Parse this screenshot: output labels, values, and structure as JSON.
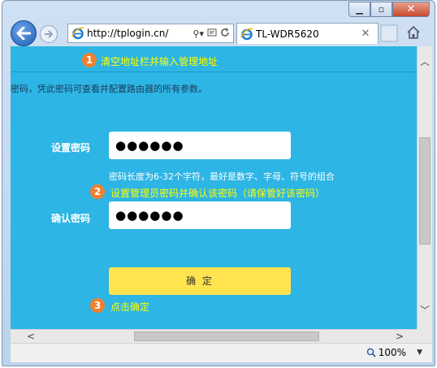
{
  "window": {
    "controls": {
      "minimize": "▁",
      "maximize": "▫",
      "close": "✕"
    }
  },
  "navigation": {
    "address_url": "http://tplogin.cn/",
    "search_glyph": "⚲▾",
    "tab_title": "TL-WDR5620",
    "tab_close": "✕"
  },
  "page": {
    "intro_text": "密码，凭此密码可查看并配置路由器的所有参数。",
    "set_password_label": "设置密码",
    "set_password_value": "●●●●●●",
    "password_hint": "密码长度为6-32个字符，最好是数字、字母、符号的组合",
    "confirm_password_label": "确认密码",
    "confirm_password_value": "●●●●●●",
    "confirm_button": "确 定"
  },
  "annotations": [
    {
      "number": "1",
      "text": "清空地址栏并输入管理地址"
    },
    {
      "number": "2",
      "text": "设置管理员密码并确认该密码（请保管好该密码）"
    },
    {
      "number": "3",
      "text": "点击确定"
    }
  ],
  "status_bar": {
    "zoom": "100%"
  },
  "colors": {
    "page_background": "#2db5e5",
    "button": "#ffe34f",
    "annotation_text": "#ffff00",
    "annotation_badge": "#f08030"
  }
}
